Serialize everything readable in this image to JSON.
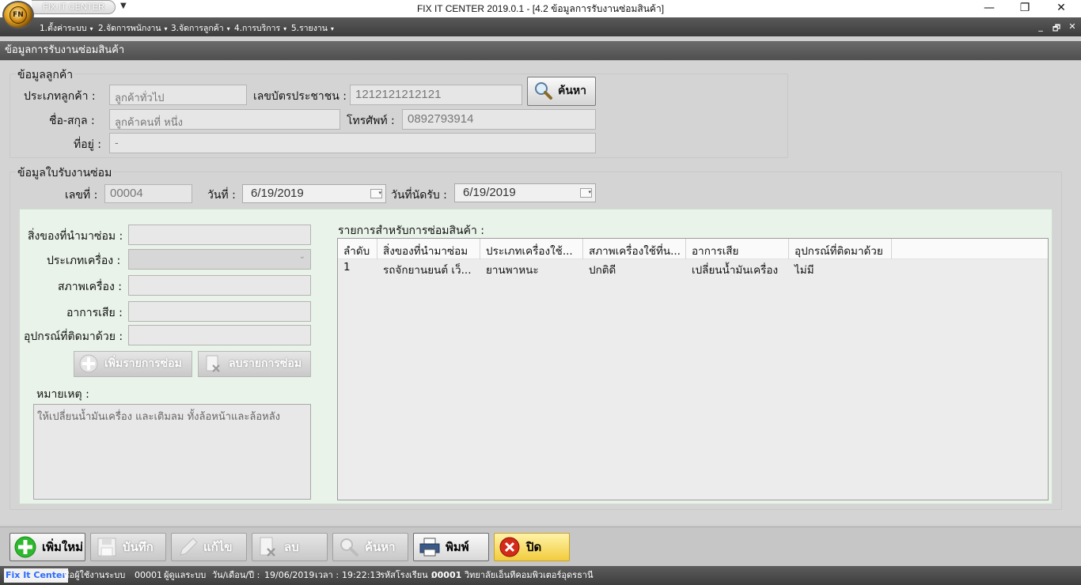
{
  "window": {
    "title": "FIX IT CENTER 2019.0.1 - [4.2 ข้อมูลการรับงานซ่อมสินค้า]",
    "quick_access_label": "FIX IT CENTER",
    "logo_text": "FN",
    "minimize_glyph": "—",
    "maximize_glyph": "❐",
    "close_glyph": "✕"
  },
  "menu": {
    "items": [
      {
        "label": "1.ตั้งค่าระบบ"
      },
      {
        "label": "2.จัดการพนักงาน"
      },
      {
        "label": "3.จัดการลูกค้า"
      },
      {
        "label": "4.การบริการ"
      },
      {
        "label": "5.รายงาน"
      }
    ],
    "caret": "▾",
    "mdi_minimize": "_",
    "mdi_restore": "🗗",
    "mdi_close": "✕"
  },
  "form": {
    "title": "ข้อมูลการรับงานซ่อมสินค้า"
  },
  "customer": {
    "group_title": "ข้อมูลลูกค้า",
    "type_label": "ประเภทลูกค้า :",
    "type_value": "ลูกค้าทั่วไป",
    "id_card_label": "เลขบัตรประชาชน :",
    "id_card_value": "1212121212121",
    "search_label": "ค้นหา",
    "name_label": "ชื่อ-สกุล :",
    "name_value": "ลูกค้าคนที่ หนึ่ง",
    "phone_label": "โทรศัพท์ :",
    "phone_value": "0892793914",
    "address_label": "ที่อยู่ :",
    "address_value": "-"
  },
  "ticket": {
    "group_title": "ข้อมูลใบรับงานซ่อม",
    "no_label": "เลขที่ :",
    "no_value": "00004",
    "date_label": "วันที่ :",
    "date_value": "6/19/2019",
    "appointment_label": "วันที่นัดรับ :",
    "appointment_value": "6/19/2019"
  },
  "item_form": {
    "item_label": "สิ่งของที่นำมาซ่อม :",
    "type_label": "ประเภทเครื่อง :",
    "condition_label": "สภาพเครื่อง :",
    "symptom_label": "อาการเสีย :",
    "accessory_label": "อุปกรณ์ที่ติดมาด้วย :",
    "add_button": "เพิ่มรายการซ่อม",
    "remove_button": "ลบรายการซ่อม",
    "notes_label": "หมายเหตุ :",
    "notes_value": "ให้เปลี่ยนน้ำมันเครื่อง และเติมลม ทั้งล้อหน้าและล้อหลัง"
  },
  "repair_list": {
    "title": "รายการสำหรับการซ่อมสินค้า :",
    "columns": [
      "ลำดับ",
      "สิ่งของที่นำมาซ่อม",
      "ประเภทเครื่องใช้...",
      "สภาพเครื่องใช้ที่น...",
      "อาการเสีย",
      "อุปกรณ์ที่ติดมาด้วย"
    ],
    "rows": [
      [
        "1",
        "รถจักยานยนต์ เว็...",
        "ยานพาหนะ",
        "ปกติดี",
        "เปลี่ยนน้ำมันเครื่อง",
        "ไม่มี"
      ]
    ]
  },
  "footer_buttons": {
    "new": "เพิ่มใหม่",
    "save": "บันทึก",
    "edit": "แก้ไข",
    "delete": "ลบ",
    "search": "ค้นหา",
    "print": "พิมพ์",
    "close": "ปิด"
  },
  "status": {
    "app_name": "Fix It Center",
    "user_label": "ชื่อผู้ใช้งานระบบ",
    "user_code": "00001",
    "user_name": "ผู้ดูแลระบบ",
    "date_label": "วัน/เดือน/ปี :",
    "date_value": "19/06/2019",
    "time_label": "เวลา :",
    "time_value": "19:22:13",
    "school_code_label": "รหัสโรงเรียน :",
    "school_code": "00001",
    "school_name": "วิทยาลัยเอ็นทีคอมพิวเตอร์อุดรธานี"
  },
  "colors": {
    "menu_bg": "#3c3c3c",
    "panel_green": "#e9f3e9",
    "app_name_blue": "#1e4fd8",
    "close_red": "#d42a1a",
    "add_green": "#2db82d",
    "close_yellow": "#f6d24a"
  }
}
